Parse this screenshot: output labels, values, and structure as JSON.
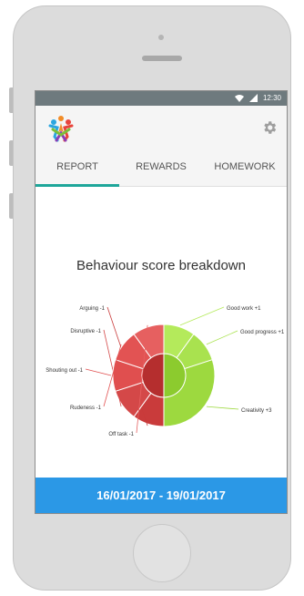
{
  "status_bar": {
    "time": "12:30",
    "wifi_icon": "wifi-icon",
    "signal_icon": "signal-icon"
  },
  "header": {
    "logo_icon": "people-logo-icon",
    "settings_icon": "gear-icon"
  },
  "tabs": [
    {
      "label": "REPORT",
      "active": true
    },
    {
      "label": "REWARDS",
      "active": false
    },
    {
      "label": "HOMEWORK",
      "active": false
    }
  ],
  "report": {
    "title": "Behaviour score breakdown",
    "date_range": "16/01/2017 - 19/01/2017"
  },
  "chart_data": {
    "type": "pie",
    "title": "Behaviour score breakdown",
    "series": [
      {
        "name": "",
        "categories": [
          "Good work +1",
          "Good progress +1",
          "Creativity +3"
        ],
        "values": [
          1,
          1,
          3
        ],
        "colors": [
          "#b4ea5b",
          "#a9e24f",
          "#9dd93f"
        ]
      },
      {
        "name": "",
        "categories": [
          "Arguing -1",
          "Disruptive -1",
          "Shouting out -1",
          "Rudeness -1",
          "Off task -1"
        ],
        "values": [
          1,
          1,
          1,
          1,
          1
        ],
        "colors": [
          "#c93b3b",
          "#d44848",
          "#e04f4f",
          "#e25353",
          "#e66060"
        ]
      }
    ]
  }
}
